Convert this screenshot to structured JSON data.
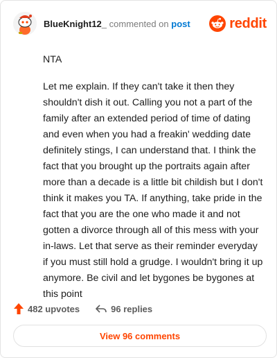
{
  "header": {
    "username": "BlueKnight12_",
    "commented_on": "commented on",
    "post_link": "post",
    "brand": "reddit"
  },
  "comment": {
    "paragraphs": [
      "NTA",
      "Let me explain. If they can't take it then they shouldn't dish it out. Calling you not a part of the family after an extended period of time of dating and even when you had a freakin' wedding date definitely stings, I can understand that. I think the fact that you brought up the portraits again after more than a decade is a little bit childish but I don't think it makes you TA. If anything, take pride in the fact that you are the one who made it and not gotten a divorce through all of this mess with your in-laws. Let that serve as their reminder everyday if you must still hold a grudge. I wouldn't bring it up anymore. Be civil and let bygones be bygones at this point"
    ]
  },
  "actions": {
    "upvotes": "482 upvotes",
    "replies": "96 replies"
  },
  "footer": {
    "view_comments": "View 96 comments"
  },
  "colors": {
    "accent": "#ff4500",
    "link": "#0079d3"
  },
  "icons": [
    "snoo-avatar-icon",
    "reddit-logo-icon",
    "upvote-arrow-icon",
    "reply-arrow-icon"
  ]
}
